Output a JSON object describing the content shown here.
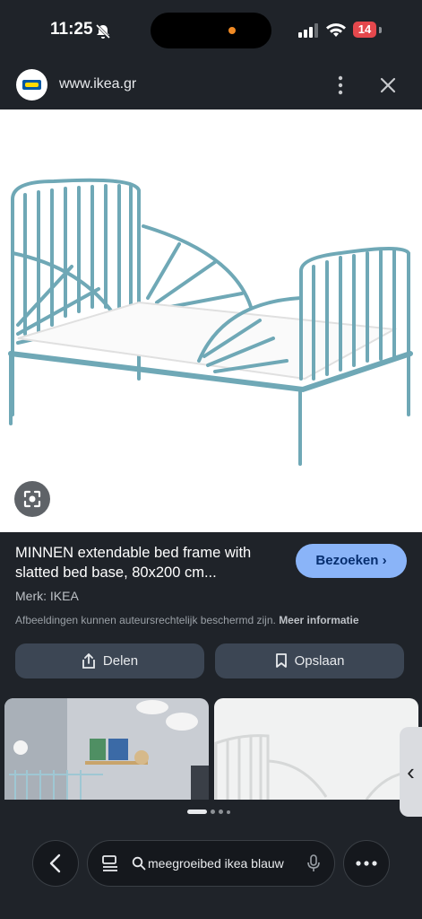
{
  "status": {
    "time": "11:25",
    "battery": "14"
  },
  "browser": {
    "url": "www.ikea.gr"
  },
  "product": {
    "title": "MINNEN extendable bed frame with slatted bed base, 80x200 cm...",
    "brand": "Merk: IKEA",
    "visit_label": "Bezoeken",
    "copyright_notice": "Afbeeldingen kunnen auteursrechtelijk beschermd zijn.",
    "more_info": "Meer informatie"
  },
  "actions": {
    "share_label": "Delen",
    "save_label": "Opslaan"
  },
  "colors": {
    "bed_frame": "#6fa8b6",
    "accent": "#8ab4f8",
    "background": "#1f2329"
  },
  "search": {
    "query": "meegroeibed ikea blauw"
  },
  "carousel": {
    "pages": 4,
    "active_index": 0
  }
}
